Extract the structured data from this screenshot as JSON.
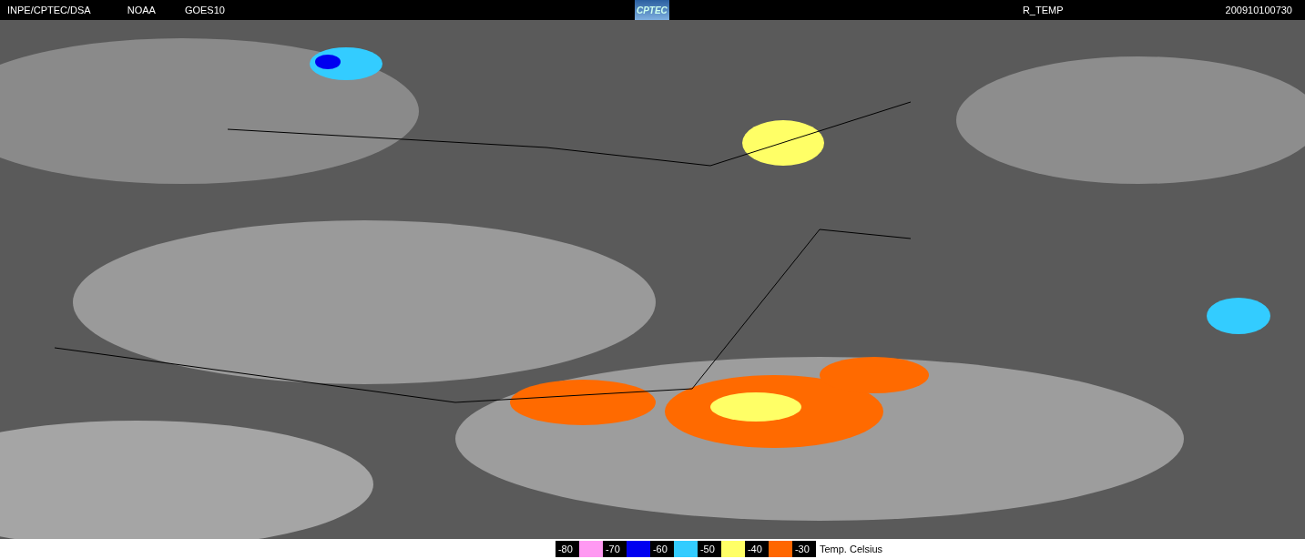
{
  "header": {
    "source": "INPE/CPTEC/DSA",
    "agency": "NOAA",
    "satellite": "GOES10",
    "logo": "CPTEC",
    "product": "R_TEMP",
    "timestamp": "200910100730"
  },
  "legend": {
    "items": [
      {
        "label": "-80",
        "color": "#ff99f2"
      },
      {
        "label": "-70",
        "color": "#0000f0"
      },
      {
        "label": "-60",
        "color": "#33ccff"
      },
      {
        "label": "-50",
        "color": "#ffff66"
      },
      {
        "label": "-40",
        "color": "#ff6600"
      },
      {
        "label": "-30"
      }
    ],
    "unit": "Temp. Celsius"
  }
}
